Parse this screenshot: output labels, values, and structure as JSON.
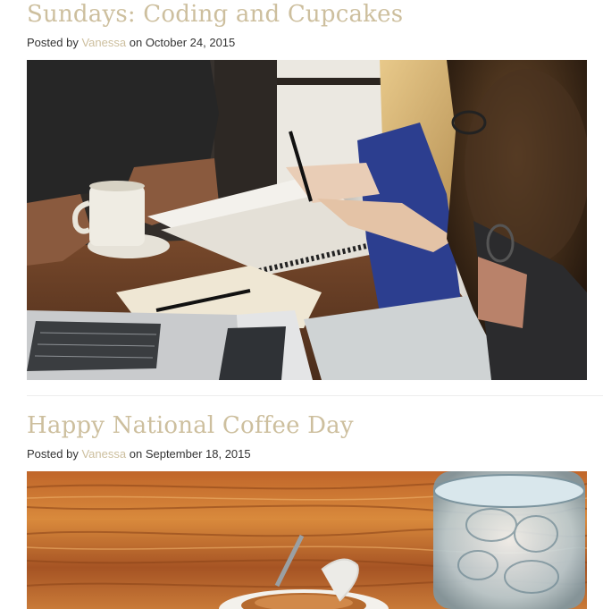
{
  "posts": [
    {
      "title": "Sundays: Coding and Cupcakes",
      "meta_prefix": "Posted by",
      "author": "Vanessa",
      "meta_mid": "on",
      "date": "October 24, 2015"
    },
    {
      "title": "Happy National Coffee Day",
      "meta_prefix": "Posted by",
      "author": "Vanessa",
      "meta_mid": "on",
      "date": "September 18, 2015"
    }
  ],
  "colors": {
    "accent": "#cdbf9e",
    "text": "#333333",
    "divider": "#ececec"
  }
}
